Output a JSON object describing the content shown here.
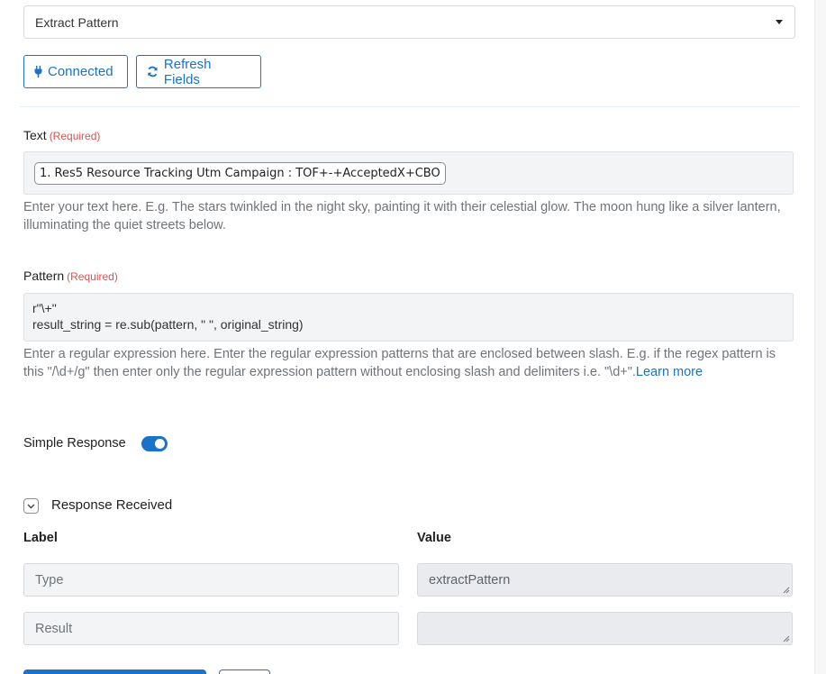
{
  "action_select": {
    "value": "Extract Pattern"
  },
  "buttons": {
    "connected_label": "Connected",
    "refresh_label": "Refresh Fields"
  },
  "text_field": {
    "label": "Text",
    "required": "(Required)",
    "pill": "1. Res5 Resource Tracking Utm Campaign : TOF+-+AcceptedX+CBO",
    "help": "Enter your text here. E.g. The stars twinkled in the night sky, painting it with their celestial glow. The moon hung like a silver lantern, illuminating the quiet streets below."
  },
  "pattern_field": {
    "label": "Pattern",
    "required": "(Required)",
    "value": "r\"\\+\"\nresult_string = re.sub(pattern, \" \", original_string)",
    "help": "Enter a regular expression here. Enter the regular expression patterns that are enclosed between slash. E.g. if the regex pattern is this \"/\\d+/g\" then enter only the regular expression pattern without enclosing slash and delimiters i.e. \"\\d+\".",
    "learn_more": "Learn more"
  },
  "simple_response": {
    "label": "Simple Response",
    "enabled": true
  },
  "response_section": {
    "title": "Response Received",
    "col_label": "Label",
    "col_value": "Value",
    "rows": [
      {
        "label": "Type",
        "value": "extractPattern"
      },
      {
        "label": "Result",
        "value": ""
      }
    ]
  },
  "colors": {
    "accent": "#1a73c8",
    "required": "#d9534f"
  }
}
